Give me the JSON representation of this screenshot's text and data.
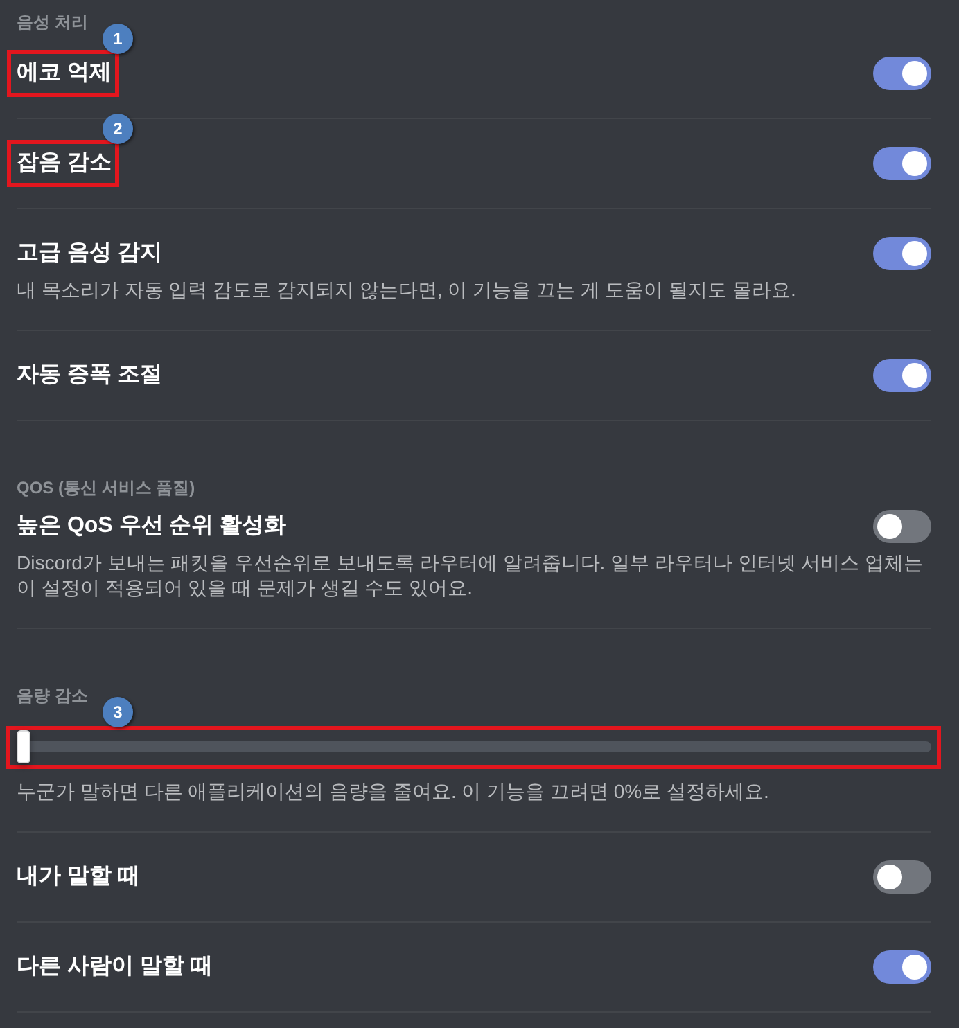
{
  "sections": [
    {
      "header": "음성 처리",
      "items": [
        {
          "kind": "toggle",
          "label": "에코 억제",
          "on": true,
          "callout": "1"
        },
        {
          "kind": "toggle",
          "label": "잡음 감소",
          "on": true,
          "callout": "2"
        },
        {
          "kind": "toggle",
          "label": "고급 음성 감지",
          "on": true,
          "description": "내 목소리가 자동 입력 감도로 감지되지 않는다면, 이 기능을 끄는 게 도움이 될지도 몰라요."
        },
        {
          "kind": "toggle",
          "label": "자동 증폭 조절",
          "on": true
        }
      ]
    },
    {
      "header": "QOS (통신 서비스 품질)",
      "items": [
        {
          "kind": "toggle",
          "label": "높은 QoS 우선 순위 활성화",
          "on": false,
          "description": "Discord가 보내는 패킷을 우선순위로 보내도록 라우터에 알려줍니다. 일부 라우터나 인터넷 서비스 업체는 이 설정이 적용되어 있을 때 문제가 생길 수도 있어요."
        }
      ]
    },
    {
      "header": "음량 감소",
      "items": [
        {
          "kind": "slider",
          "level": 0,
          "callout": "3",
          "description": "누군가 말하면 다른 애플리케이션의 음량을 줄여요. 이 기능을 끄려면 0%로 설정하세요."
        },
        {
          "kind": "toggle",
          "label": "내가 말할 때",
          "on": false
        },
        {
          "kind": "toggle",
          "label": "다른 사람이 말할 때",
          "on": true
        }
      ]
    }
  ]
}
